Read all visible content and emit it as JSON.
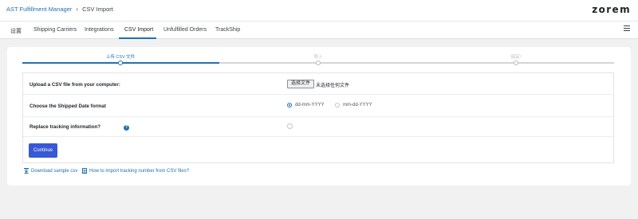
{
  "topbar": {
    "breadcrumb_root": "AST Fulfillment Manager",
    "breadcrumb_separator": "›",
    "breadcrumb_current": "CSV Import",
    "logo": "zorem"
  },
  "tabs": [
    {
      "label": "设置"
    },
    {
      "label": "Shipping Carriers"
    },
    {
      "label": "Integrations"
    },
    {
      "label": "CSV Import"
    },
    {
      "label": "Unfulfilled Orders"
    },
    {
      "label": "TrackShip"
    }
  ],
  "active_tab": "CSV Import",
  "stepper": {
    "steps": [
      {
        "label": "上传 CSV 文件"
      },
      {
        "label": "导入"
      },
      {
        "label": "搞定!"
      }
    ],
    "current_step": 1
  },
  "form": {
    "upload_label": "Upload a CSV file from your computer:",
    "file_button": "选择文件",
    "file_status": "未选择任何文件",
    "date_format_label": "Choose the Shipped Date format",
    "date_formats": [
      {
        "label": "dd-mm-YYYY",
        "checked": true
      },
      {
        "label": "mm-dd-YYYY",
        "checked": false
      }
    ],
    "replace_label": "Replace tracking information?",
    "help_icon": "question-circle-icon",
    "replace_checked": false,
    "continue_button": "Continue"
  },
  "footer": {
    "download_link": "Download sample csv",
    "download_icon": "download-icon",
    "howto_link": "How to import tracking number from CSV files?",
    "howto_icon": "document-icon"
  },
  "colors": {
    "accent": "#2271b1",
    "button": "#3858d6"
  }
}
